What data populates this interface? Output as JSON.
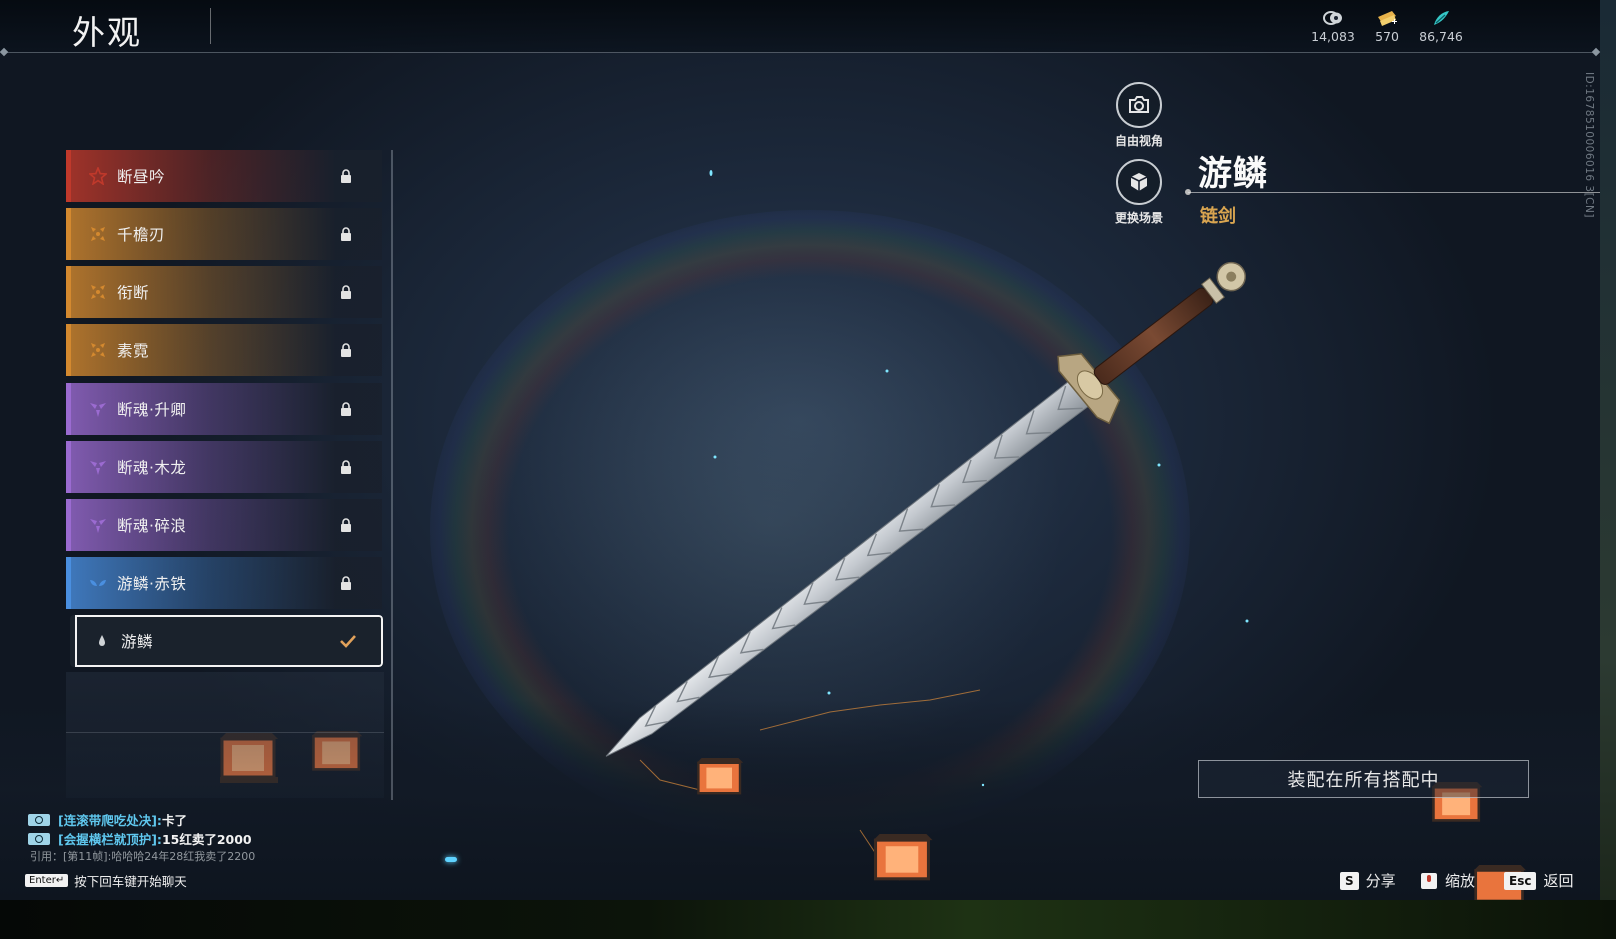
{
  "header": {
    "title": "外观",
    "currencies": [
      {
        "icon": "coin-stack-icon",
        "value": "14,083"
      },
      {
        "icon": "gold-ticket-icon",
        "value": "570"
      },
      {
        "icon": "jade-feather-icon",
        "value": "86,746"
      }
    ]
  },
  "skins": [
    {
      "label": "断昼吟",
      "rarity": "red",
      "icon": "star-emblem-icon",
      "locked": true
    },
    {
      "label": "千檐刃",
      "rarity": "orange",
      "icon": "four-petal-emblem-icon",
      "locked": true
    },
    {
      "label": "衔断",
      "rarity": "orange",
      "icon": "four-petal-emblem-icon",
      "locked": true
    },
    {
      "label": "素霓",
      "rarity": "orange",
      "icon": "four-petal-emblem-icon",
      "locked": true
    },
    {
      "label": "断魂·升卿",
      "rarity": "purple",
      "icon": "tri-leaf-emblem-icon",
      "locked": true
    },
    {
      "label": "断魂·木龙",
      "rarity": "purple",
      "icon": "tri-leaf-emblem-icon",
      "locked": true
    },
    {
      "label": "断魂·碎浪",
      "rarity": "purple",
      "icon": "tri-leaf-emblem-icon",
      "locked": true
    },
    {
      "label": "游鳞·赤铁",
      "rarity": "blue",
      "icon": "double-leaf-emblem-icon",
      "locked": true
    },
    {
      "label": "游鳞",
      "rarity": "white",
      "icon": "drop-emblem-icon",
      "locked": false,
      "selected": true
    }
  ],
  "side_buttons": {
    "free_view": "自由视角",
    "change_scene": "更换场景"
  },
  "detail": {
    "name": "游鳞",
    "type": "链剑",
    "equip_all": "装配在所有搭配中"
  },
  "id_text": "ID:1678510006016 3[CN]",
  "chat": {
    "lines": [
      {
        "channel": "[连滚带爬吃处决]:",
        "message": "卡了"
      },
      {
        "channel": "[会握横栏就顶护]:",
        "message": "15红卖了2000"
      }
    ],
    "quote": "引用：[第11帧]:哈哈哈24年28红我卖了2200",
    "enter_key": "Enter↵",
    "enter_hint": "按下回车键开始聊天"
  },
  "hints": {
    "share_key": "S",
    "share": "分享",
    "zoom": "缩放",
    "back_key": "Esc",
    "back": "返回"
  },
  "colors": {
    "red": "#c0392b",
    "orange": "#d4892f",
    "purple": "#9b6bd1",
    "blue": "#4a8fe0",
    "white": "#cfd3d6",
    "accent_gold": "#d9a550"
  }
}
